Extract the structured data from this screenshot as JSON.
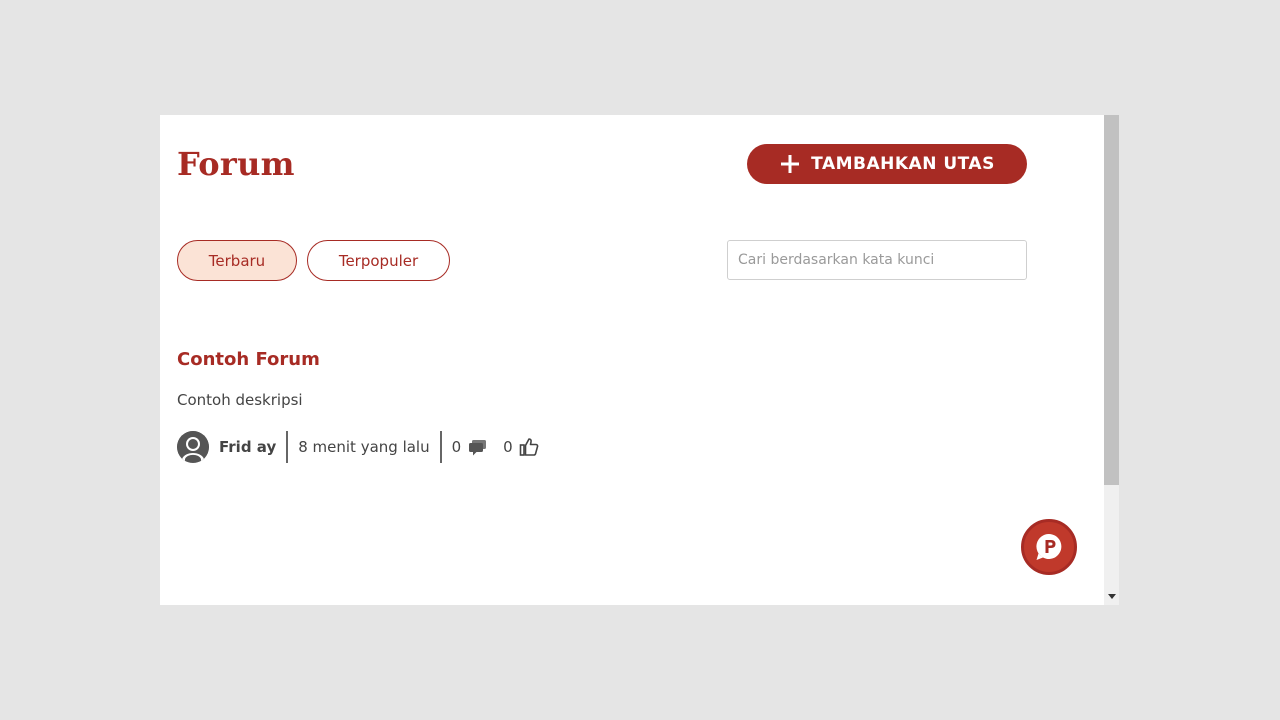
{
  "page": {
    "title": "Forum",
    "add_button_label": "TAMBAHKAN UTAS"
  },
  "tabs": [
    {
      "label": "Terbaru",
      "active": true
    },
    {
      "label": "Terpopuler",
      "active": false
    }
  ],
  "search": {
    "placeholder": "Cari berdasarkan kata kunci",
    "value": ""
  },
  "posts": [
    {
      "title": "Contoh Forum",
      "description": "Contoh deskripsi",
      "author": "Frid ay",
      "time": "8 menit yang lalu",
      "comments": "0",
      "likes": "0"
    }
  ],
  "icons": {
    "add": "plus-icon",
    "avatar": "user-avatar-icon",
    "comments": "comment-icon",
    "likes": "thumbs-up-icon",
    "fab": "chat-bubble-p-icon",
    "scroll": "arrow-down-icon"
  },
  "colors": {
    "accent": "#a72b24",
    "active_tab_bg": "#fbe3d6",
    "page_bg": "#e5e5e5"
  }
}
